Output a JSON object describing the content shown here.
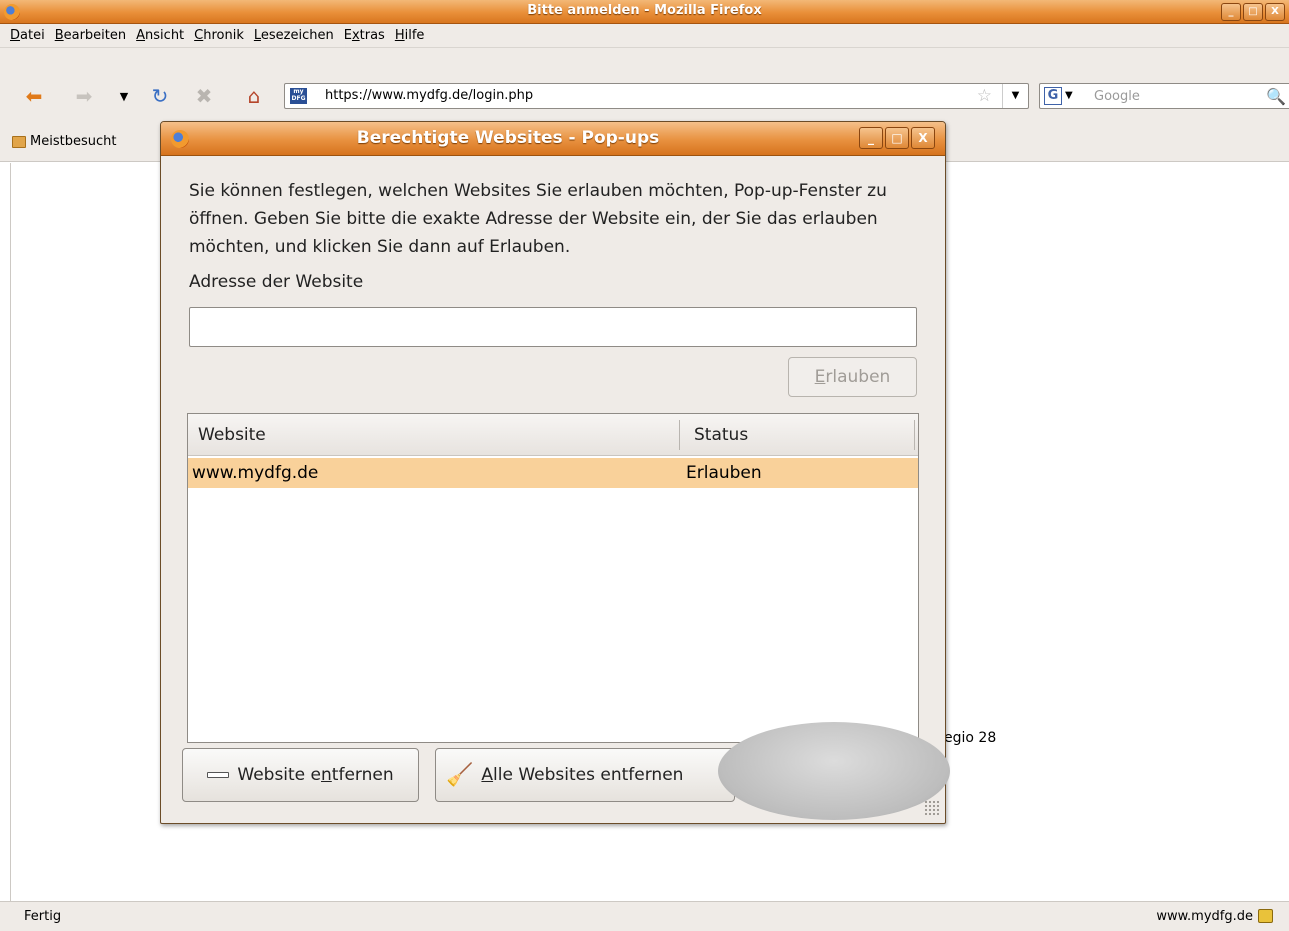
{
  "window": {
    "title": "Bitte anmelden - Mozilla Firefox",
    "controls": [
      "_",
      "□",
      "X"
    ]
  },
  "menubar": {
    "items": [
      {
        "pre": "",
        "key": "D",
        "post": "atei"
      },
      {
        "pre": "",
        "key": "B",
        "post": "earbeiten"
      },
      {
        "pre": "",
        "key": "A",
        "post": "nsicht"
      },
      {
        "pre": "",
        "key": "C",
        "post": "hronik"
      },
      {
        "pre": "",
        "key": "L",
        "post": "esezeichen"
      },
      {
        "pre": "E",
        "key": "x",
        "post": "tras"
      },
      {
        "pre": "",
        "key": "H",
        "post": "ilfe"
      }
    ]
  },
  "navbar": {
    "url": "https://www.mydfg.de/login.php",
    "site_icon_text": "my DFG",
    "search_placeholder": "Google"
  },
  "bookmarks": {
    "item": "Meistbesucht"
  },
  "page": {
    "partial_text": "egio 28"
  },
  "statusbar": {
    "status": "Fertig",
    "domain": "www.mydfg.de"
  },
  "dialog": {
    "title": "Berechtigte Websites - Pop-ups",
    "description": "Sie können festlegen, welchen Websites Sie erlauben möchten, Pop-up-Fenster zu öffnen. Geben Sie bitte die exakte Adresse der Website ein, der Sie das erlauben möchten, und klicken Sie dann auf Erlauben.",
    "address_label": "Adresse der Website",
    "address_value": "",
    "allow_button": {
      "key": "E",
      "post": "rlauben"
    },
    "columns": [
      "Website",
      "Status"
    ],
    "rows": [
      {
        "website": "www.mydfg.de",
        "status": "Erlauben"
      }
    ],
    "remove_button": {
      "pre": "Website e",
      "key": "n",
      "post": "tfernen"
    },
    "remove_all_button": {
      "pre": "",
      "key": "A",
      "post": "lle Websites entfernen"
    }
  }
}
